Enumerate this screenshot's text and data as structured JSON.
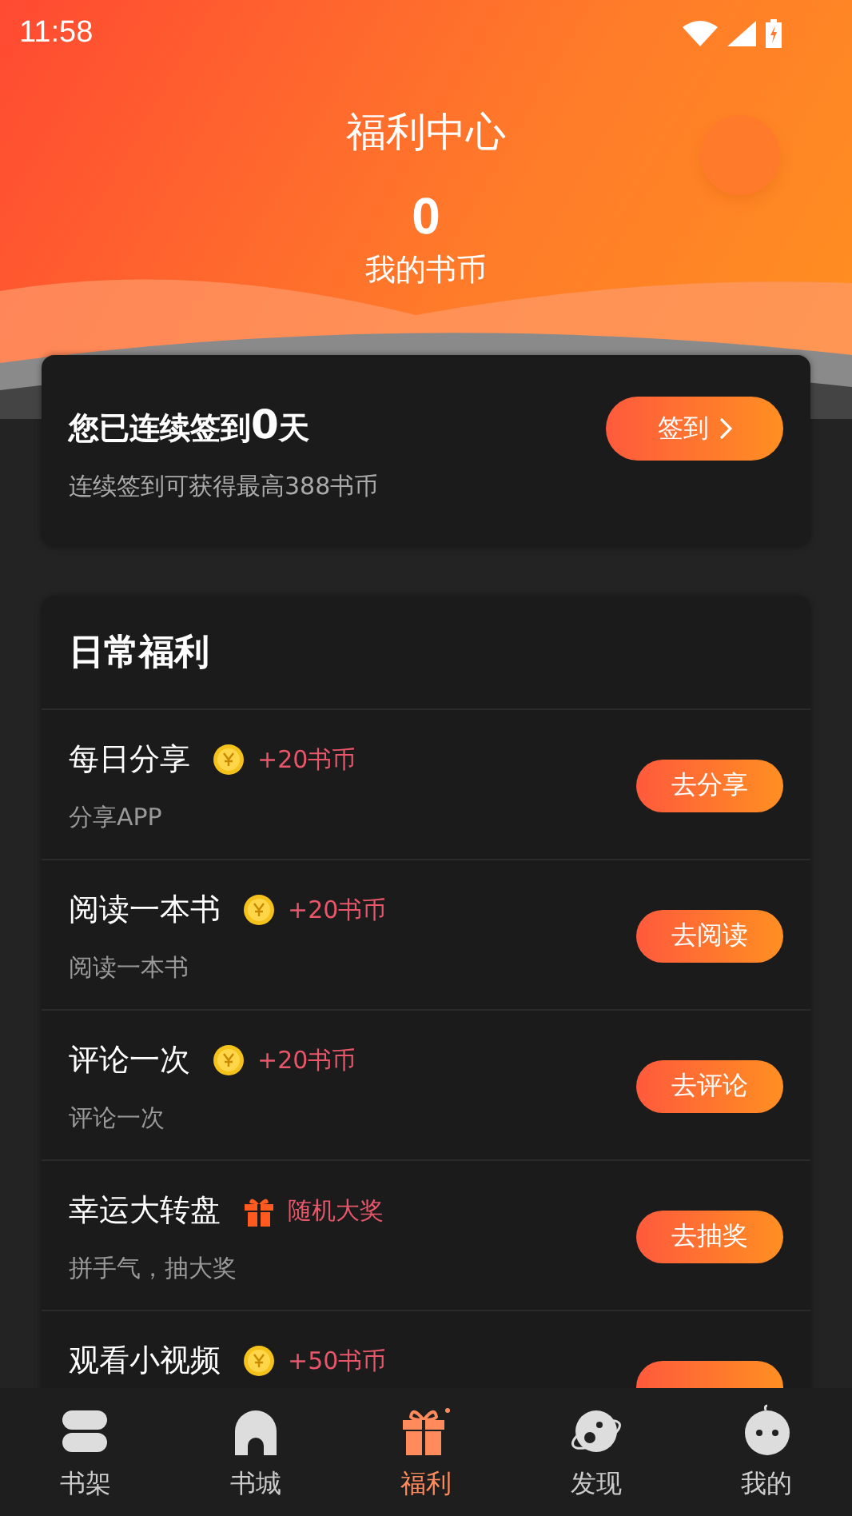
{
  "status_bar": {
    "time": "11:58"
  },
  "header": {
    "title": "福利中心",
    "coins": "0",
    "coins_label": "我的书币"
  },
  "checkin": {
    "prefix": "您已连续签到",
    "days": "0",
    "suffix": "天",
    "subtitle": "连续签到可获得最高388书币",
    "button": "签到"
  },
  "daily": {
    "title": "日常福利",
    "tasks": [
      {
        "name": "每日分享",
        "kind": "coin",
        "reward": "+20书币",
        "desc": "分享APP",
        "button": "去分享"
      },
      {
        "name": "阅读一本书",
        "kind": "coin",
        "reward": "+20书币",
        "desc": "阅读一本书",
        "button": "去阅读"
      },
      {
        "name": "评论一次",
        "kind": "coin",
        "reward": "+20书币",
        "desc": "评论一次",
        "button": "去评论"
      },
      {
        "name": "幸运大转盘",
        "kind": "gift",
        "reward": "随机大奖",
        "desc": "拼手气，抽大奖",
        "button": "去抽奖"
      },
      {
        "name": "观看小视频",
        "kind": "coin",
        "reward": "+50书币"
      }
    ]
  },
  "tabs": [
    {
      "label": "书架",
      "kind": "shelf",
      "selected": false
    },
    {
      "label": "书城",
      "kind": "store",
      "selected": false
    },
    {
      "label": "福利",
      "kind": "gift",
      "selected": true
    },
    {
      "label": "发现",
      "kind": "planet",
      "selected": false
    },
    {
      "label": "我的",
      "kind": "face",
      "selected": false
    }
  ]
}
